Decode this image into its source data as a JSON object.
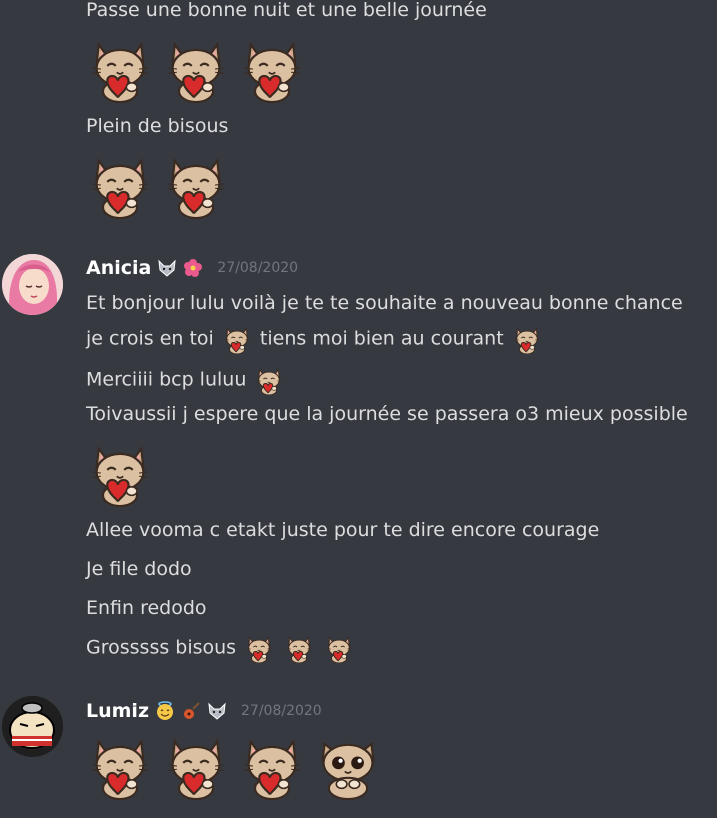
{
  "messages": {
    "top": {
      "line1": "Passe une bonne nuit et une belle journée",
      "line2": "Plein de bisous"
    },
    "anicia": {
      "username": "Anicia",
      "timestamp": "27/08/2020",
      "badges": [
        "wolf-emoji",
        "hibiscus-emoji"
      ],
      "line1": "Et bonjour lulu voilà je te te souhaite a nouveau bonne chance",
      "line2a": "je crois en toi",
      "line2b": "tiens moi bien au courant",
      "line3": "Merciiii bcp luluu",
      "line4": "Toivaussii j espere que la journée se passera o3 mieux possible",
      "line5": "Allee vooma c etakt juste pour te dire encore courage",
      "line6": "Je file dodo",
      "line7": "Enfin redodo",
      "line8": "Grosssss bisous"
    },
    "lumiz": {
      "username": "Lumiz",
      "timestamp": "27/08/2020",
      "badges": [
        "angel-face-emoji",
        "guitar-emoji",
        "wolf-emoji"
      ]
    }
  },
  "colors": {
    "background": "#36393f",
    "text": "#dcddde",
    "username": "#ffffff",
    "timestamp": "#72767d"
  }
}
